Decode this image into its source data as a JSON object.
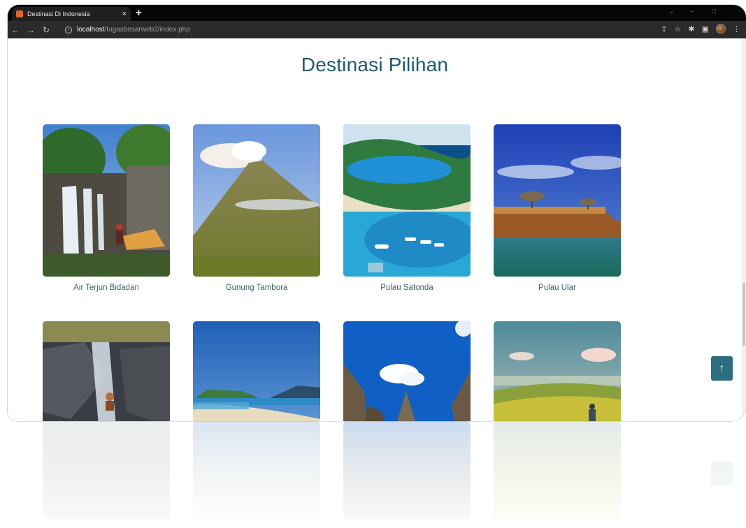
{
  "browser": {
    "tab_title": "Destinasi Di Indonesia",
    "tab_close": "×",
    "new_tab": "+",
    "url_host": "localhost",
    "url_path": "/tugasbesarweb2/index.php"
  },
  "page": {
    "heading": "Destinasi Pilihan",
    "back_to_top": "↑"
  },
  "destinations": [
    {
      "name": "Air Terjun Bidadari"
    },
    {
      "name": "Gunung Tambora"
    },
    {
      "name": "Pulau Satonda"
    },
    {
      "name": "Pulau Ular"
    }
  ],
  "colors": {
    "heading": "#1c5a6e",
    "accent": "#2a6e7f"
  }
}
